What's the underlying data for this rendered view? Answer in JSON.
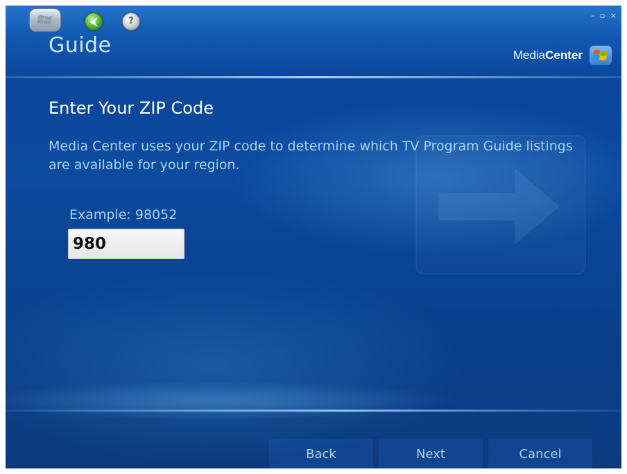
{
  "window": {
    "section_title": "Guide",
    "controls": {
      "minimize": "–",
      "restore": "▫",
      "close": "×"
    },
    "toolbar_icons": [
      "windows-start-icon",
      "back-arrow-icon",
      "help-icon"
    ]
  },
  "brand": {
    "prefix": "Media",
    "suffix": "Center"
  },
  "content": {
    "title": "Enter Your ZIP Code",
    "description": "Media Center uses your ZIP code to determine which TV Program Guide listings are available for your region.",
    "example_label": "Example: 98052",
    "zip_value": "980"
  },
  "footer": {
    "back_label": "Back",
    "next_label": "Next",
    "cancel_label": "Cancel"
  },
  "colors": {
    "background": "#0a4699",
    "text_primary": "#ffffff",
    "text_secondary": "#a9d3f8",
    "input_bg": "#eeeeee"
  }
}
